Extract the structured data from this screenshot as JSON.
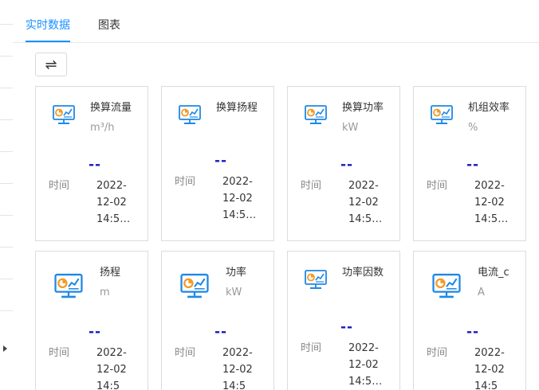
{
  "tabs": [
    {
      "label": "实时数据",
      "active": true
    },
    {
      "label": "图表",
      "active": false
    }
  ],
  "toolbar": {
    "swap_icon": "⇌"
  },
  "colors": {
    "accent": "#1890ff",
    "value": "#1a1ab8",
    "icon_blue": "#1e88e5",
    "icon_orange": "#f59a23"
  },
  "time_label": "时间",
  "cards": [
    {
      "name": "换算流量",
      "unit": "m³/h",
      "value": "--",
      "time": "2022-\n12-02\n14:5…",
      "icon": "monitor-chart-icon"
    },
    {
      "name": "换算扬程",
      "unit": "",
      "value": "--",
      "time": "2022-\n12-02\n14:5…",
      "icon": "monitor-chart-icon"
    },
    {
      "name": "换算功率",
      "unit": "kW",
      "value": "--",
      "time": "2022-\n12-02\n14:5…",
      "icon": "monitor-chart-icon"
    },
    {
      "name": "机组效率",
      "unit": "%",
      "value": "--",
      "time": "2022-\n12-02\n14:5…",
      "icon": "monitor-chart-icon"
    },
    {
      "name": "扬程",
      "unit": "m",
      "value": "--",
      "time": "2022-\n12-02\n14:5",
      "icon": "monitor-chart-icon"
    },
    {
      "name": "功率",
      "unit": "kW",
      "value": "--",
      "time": "2022-\n12-02\n14:5",
      "icon": "monitor-chart-icon"
    },
    {
      "name": "功率因数",
      "unit": "",
      "value": "--",
      "time": "2022-\n12-02\n14:5…",
      "icon": "monitor-chart-icon"
    },
    {
      "name": "电流_c",
      "unit": "A",
      "value": "--",
      "time": "2022-\n12-02\n14:5",
      "icon": "monitor-chart-icon"
    }
  ]
}
